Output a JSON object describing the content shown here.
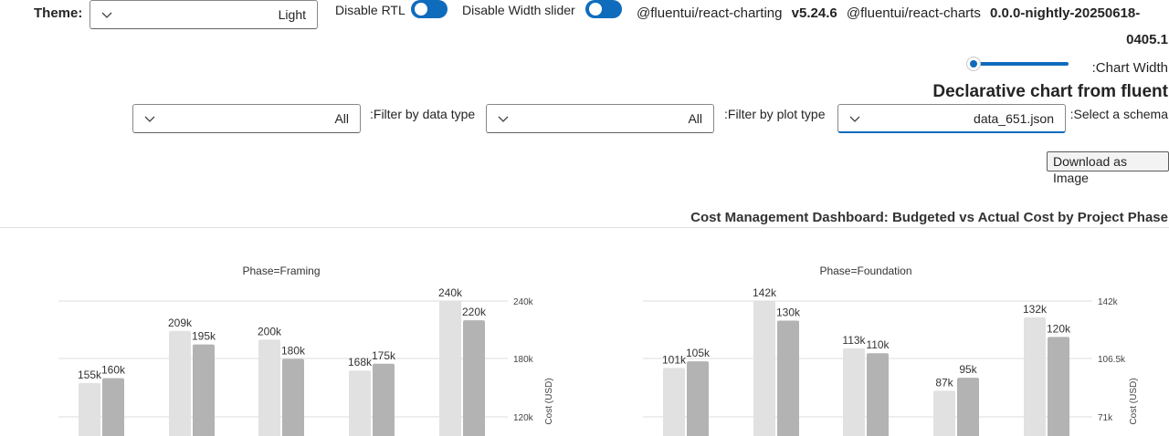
{
  "theme": {
    "label": "Theme:",
    "value": "Light"
  },
  "toggles": {
    "rtl_label": "Disable RTL",
    "width_label": "Disable Width slider"
  },
  "versions": {
    "pkg1": "@fluentui/react-charting",
    "ver1": "v5.24.6",
    "pkg2": "@fluentui/react-charts",
    "ver2_line1": "0.0.0-nightly-20250618-",
    "ver2_line2": "0405.1"
  },
  "slider": {
    "label": ":Chart Width"
  },
  "heading": "Declarative chart from fluent",
  "filters": {
    "data_type_label": ":Filter by data type",
    "data_type_value": "All",
    "plot_type_label": ":Filter by plot type",
    "plot_type_value": "All",
    "schema_label": ":Select a schema",
    "schema_value": "data_651.json"
  },
  "download_label": "Download as Image",
  "chart_title": "Cost Management Dashboard: Budgeted vs Actual Cost by Project Phase",
  "colors": {
    "accent": "#0f6cbd",
    "budget": "#e1e1e1",
    "actual": "#b3b3b3"
  },
  "chart_data": [
    {
      "type": "bar",
      "title": "Phase=Framing",
      "ylabel": "Cost (USD)",
      "yticks": [
        "240k",
        "180k",
        "120k"
      ],
      "ytick_values": [
        240000,
        180000,
        120000
      ],
      "series": [
        {
          "values": [
            155000,
            209000,
            200000,
            168000,
            240000
          ],
          "labels": [
            "155k",
            "209k",
            "200k",
            "168k",
            "240k"
          ]
        },
        {
          "values": [
            160000,
            195000,
            180000,
            175000,
            220000
          ],
          "labels": [
            "160k",
            "195k",
            "180k",
            "175k",
            "220k"
          ]
        }
      ]
    },
    {
      "type": "bar",
      "title": "Phase=Foundation",
      "ylabel": "Cost (USD)",
      "yticks": [
        "142k",
        "106.5k",
        "71k"
      ],
      "ytick_values": [
        142000,
        106500,
        71000
      ],
      "series": [
        {
          "values": [
            101000,
            142000,
            113000,
            87000,
            132000
          ],
          "labels": [
            "101k",
            "142k",
            "113k",
            "87k",
            "132k"
          ]
        },
        {
          "values": [
            105000,
            130000,
            110000,
            95000,
            120000
          ],
          "labels": [
            "105k",
            "130k",
            "110k",
            "95k",
            "120k"
          ]
        }
      ]
    }
  ]
}
